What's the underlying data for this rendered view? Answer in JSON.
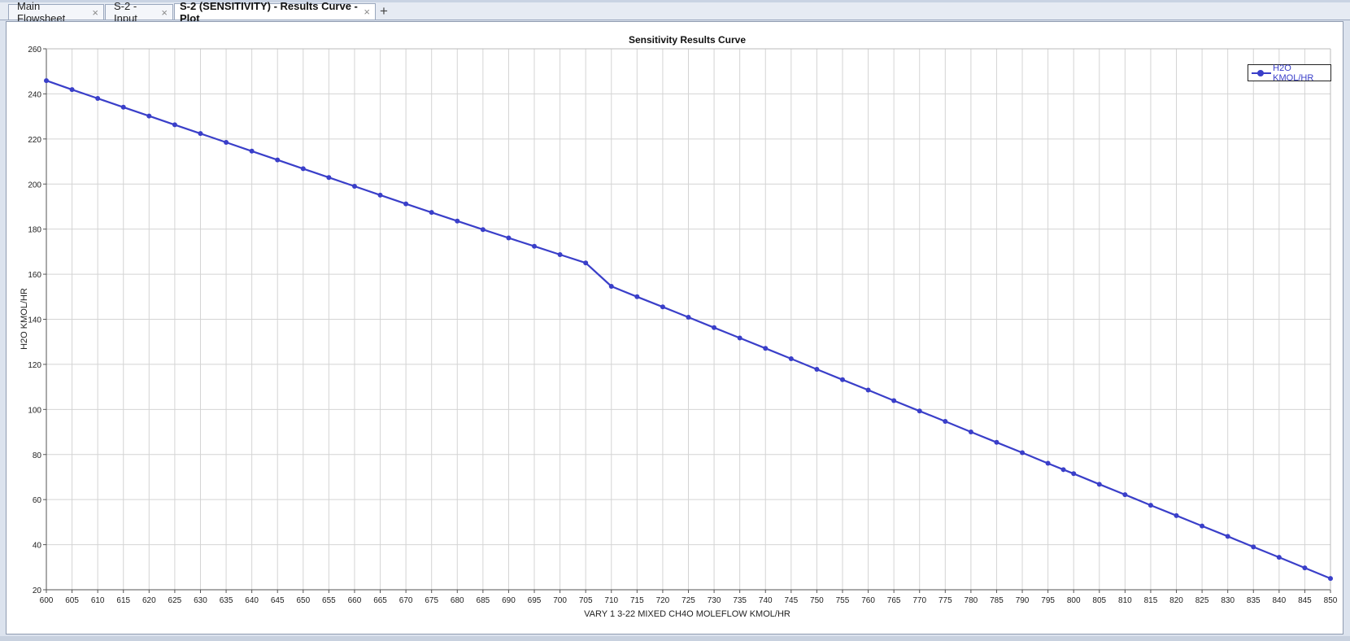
{
  "tabs": [
    {
      "label": "Main Flowsheet",
      "active": false
    },
    {
      "label": "S-2 - Input",
      "active": false
    },
    {
      "label": "S-2 (SENSITIVITY) - Results Curve - Plot",
      "active": true
    }
  ],
  "add_tab_label": "+",
  "close_glyph": "×",
  "colors": {
    "series": "#3a3fc9",
    "grid": "#d4d4d4",
    "axis": "#555555"
  },
  "chart_data": {
    "type": "line",
    "title": "Sensitivity Results Curve",
    "xlabel": "VARY   1 3-22 MIXED CH4O MOLEFLOW KMOL/HR",
    "ylabel": "H2O KMOL/HR",
    "xlim": [
      600,
      850
    ],
    "ylim": [
      20,
      260
    ],
    "x_ticks": [
      600,
      605,
      610,
      615,
      620,
      625,
      630,
      635,
      640,
      645,
      650,
      655,
      660,
      665,
      670,
      675,
      680,
      685,
      690,
      695,
      700,
      705,
      710,
      715,
      720,
      725,
      730,
      735,
      740,
      745,
      750,
      755,
      760,
      765,
      770,
      775,
      780,
      785,
      790,
      795,
      800,
      805,
      810,
      815,
      820,
      825,
      830,
      835,
      840,
      845,
      850
    ],
    "y_ticks": [
      20,
      40,
      60,
      80,
      100,
      120,
      140,
      160,
      180,
      200,
      220,
      240,
      260
    ],
    "grid": true,
    "legend_position": "top-right",
    "series": [
      {
        "name": "H2O KMOL/HR",
        "x": [
          600,
          605,
          610,
          615,
          620,
          625,
          630,
          635,
          640,
          645,
          650,
          655,
          660,
          665,
          670,
          675,
          680,
          685,
          690,
          695,
          700,
          705,
          710,
          715,
          720,
          725,
          730,
          735,
          740,
          745,
          750,
          755,
          760,
          765,
          770,
          775,
          780,
          785,
          790,
          795,
          798,
          800,
          805,
          810,
          815,
          820,
          825,
          830,
          835,
          840,
          845,
          850
        ],
        "y": [
          245.9,
          241.9,
          238.0,
          234.1,
          230.2,
          226.3,
          222.4,
          218.5,
          214.6,
          210.7,
          206.8,
          202.9,
          199.0,
          195.1,
          191.2,
          187.4,
          183.6,
          179.8,
          176.1,
          172.4,
          168.7,
          165.0,
          154.6,
          150.0,
          145.5,
          140.9,
          136.3,
          131.7,
          127.1,
          122.5,
          117.8,
          113.2,
          108.6,
          103.9,
          99.3,
          94.7,
          90.0,
          85.4,
          80.8,
          76.1,
          73.3,
          71.5,
          66.8,
          62.2,
          57.5,
          52.9,
          48.3,
          43.7,
          39.0,
          34.4,
          29.7,
          25.0
        ]
      }
    ]
  }
}
